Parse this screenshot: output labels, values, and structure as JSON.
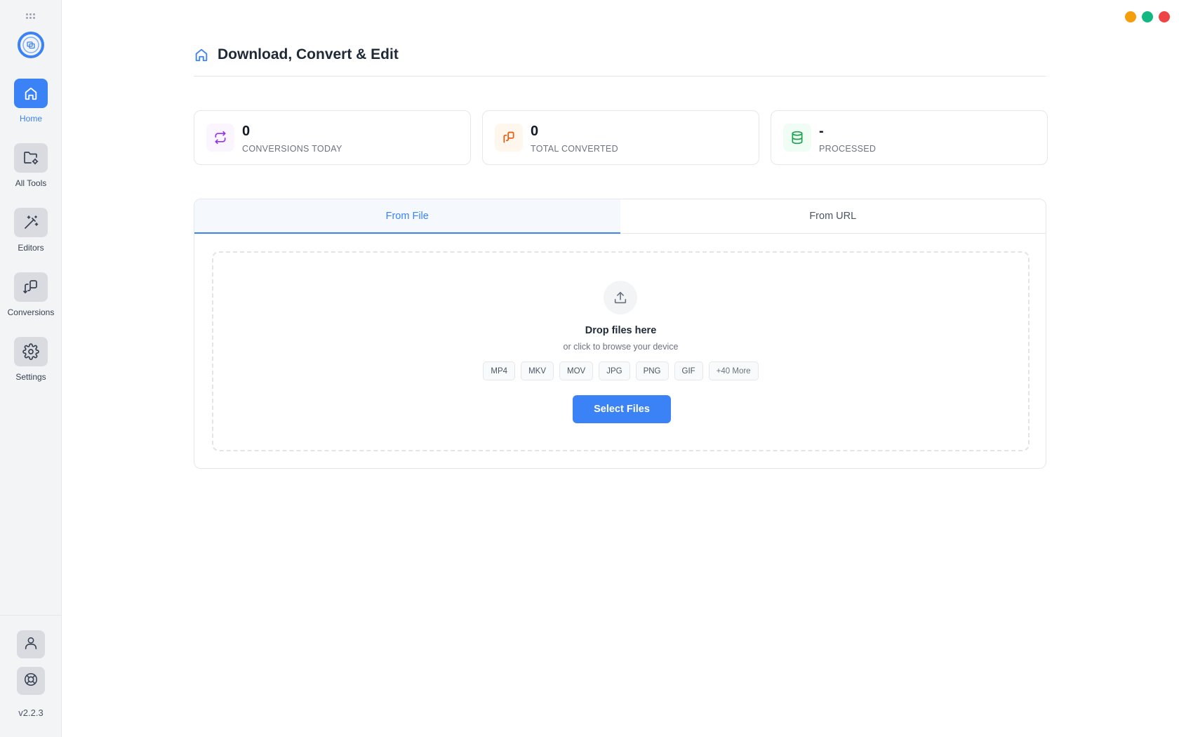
{
  "window": {
    "controls": [
      {
        "name": "minimize",
        "color": "#f59e0b"
      },
      {
        "name": "maximize",
        "color": "#10b981"
      },
      {
        "name": "close",
        "color": "#ef4444"
      }
    ]
  },
  "sidebar": {
    "logo_icon": "app-logo-icon",
    "items": [
      {
        "label": "Home",
        "icon": "home-icon",
        "active": true
      },
      {
        "label": "All Tools",
        "icon": "folder-gear-icon",
        "active": false
      },
      {
        "label": "Editors",
        "icon": "magic-wand-icon",
        "active": false
      },
      {
        "label": "Conversions",
        "icon": "copy-convert-icon",
        "active": false
      },
      {
        "label": "Settings",
        "icon": "gear-icon",
        "active": false
      }
    ],
    "bottom": [
      {
        "icon": "user-icon"
      },
      {
        "icon": "lifebuoy-icon"
      }
    ],
    "version": "v2.2.3"
  },
  "header": {
    "icon": "home-icon",
    "title": "Download, Convert & Edit"
  },
  "stats": [
    {
      "value": "0",
      "label": "CONVERSIONS TODAY",
      "icon": "repeat-icon",
      "accent": "#9333ea",
      "bg": "#faf5ff"
    },
    {
      "value": "0",
      "label": "TOTAL CONVERTED",
      "icon": "copy-convert-icon",
      "accent": "#ea580c",
      "bg": "#fff7ed"
    },
    {
      "value": "-",
      "label": "PROCESSED",
      "icon": "database-icon",
      "accent": "#16a34a",
      "bg": "#f0fdf4"
    }
  ],
  "tabs": [
    {
      "label": "From File",
      "active": true
    },
    {
      "label": "From URL",
      "active": false
    }
  ],
  "dropzone": {
    "icon": "upload-icon",
    "title": "Drop files here",
    "subtitle": "or click to browse your device",
    "formats": [
      "MP4",
      "MKV",
      "MOV",
      "JPG",
      "PNG",
      "GIF",
      "+40 More"
    ],
    "button_label": "Select Files"
  },
  "colors": {
    "accent": "#3b82f6"
  }
}
